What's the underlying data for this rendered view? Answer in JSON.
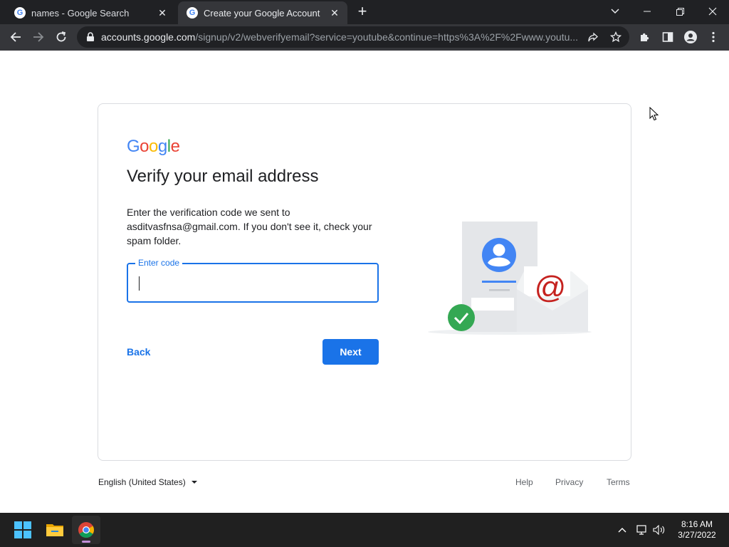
{
  "browser": {
    "tabs": [
      {
        "title": "names - Google Search",
        "favicon": "google-g-icon"
      },
      {
        "title": "Create your Google Account",
        "favicon": "google-g-icon"
      }
    ],
    "url_host": "accounts.google.com",
    "url_path": "/signup/v2/webverifyemail?service=youtube&continue=https%3A%2F%2Fwww.youtu...",
    "favicon_letter": "G"
  },
  "page": {
    "logo": {
      "G": "G",
      "o1": "o",
      "o2": "o",
      "g": "g",
      "l": "l",
      "e": "e"
    },
    "heading": "Verify your email address",
    "description_line1": "Enter the verification code we sent to",
    "email": "asditvasfnsa@gmail.com",
    "description_line2": ". If you don't see it, check your spam folder.",
    "code_field": {
      "label": "Enter code",
      "value": ""
    },
    "back_label": "Back",
    "next_label": "Next"
  },
  "footer": {
    "language": "English (United States)",
    "help": "Help",
    "privacy": "Privacy",
    "terms": "Terms"
  },
  "taskbar": {
    "time": "8:16 AM",
    "date": "3/27/2022"
  },
  "colors": {
    "accent": "#1a73e8",
    "google_blue": "#4285f4",
    "google_red": "#ea4335",
    "google_yellow": "#fbbc05",
    "google_green": "#34a853"
  }
}
